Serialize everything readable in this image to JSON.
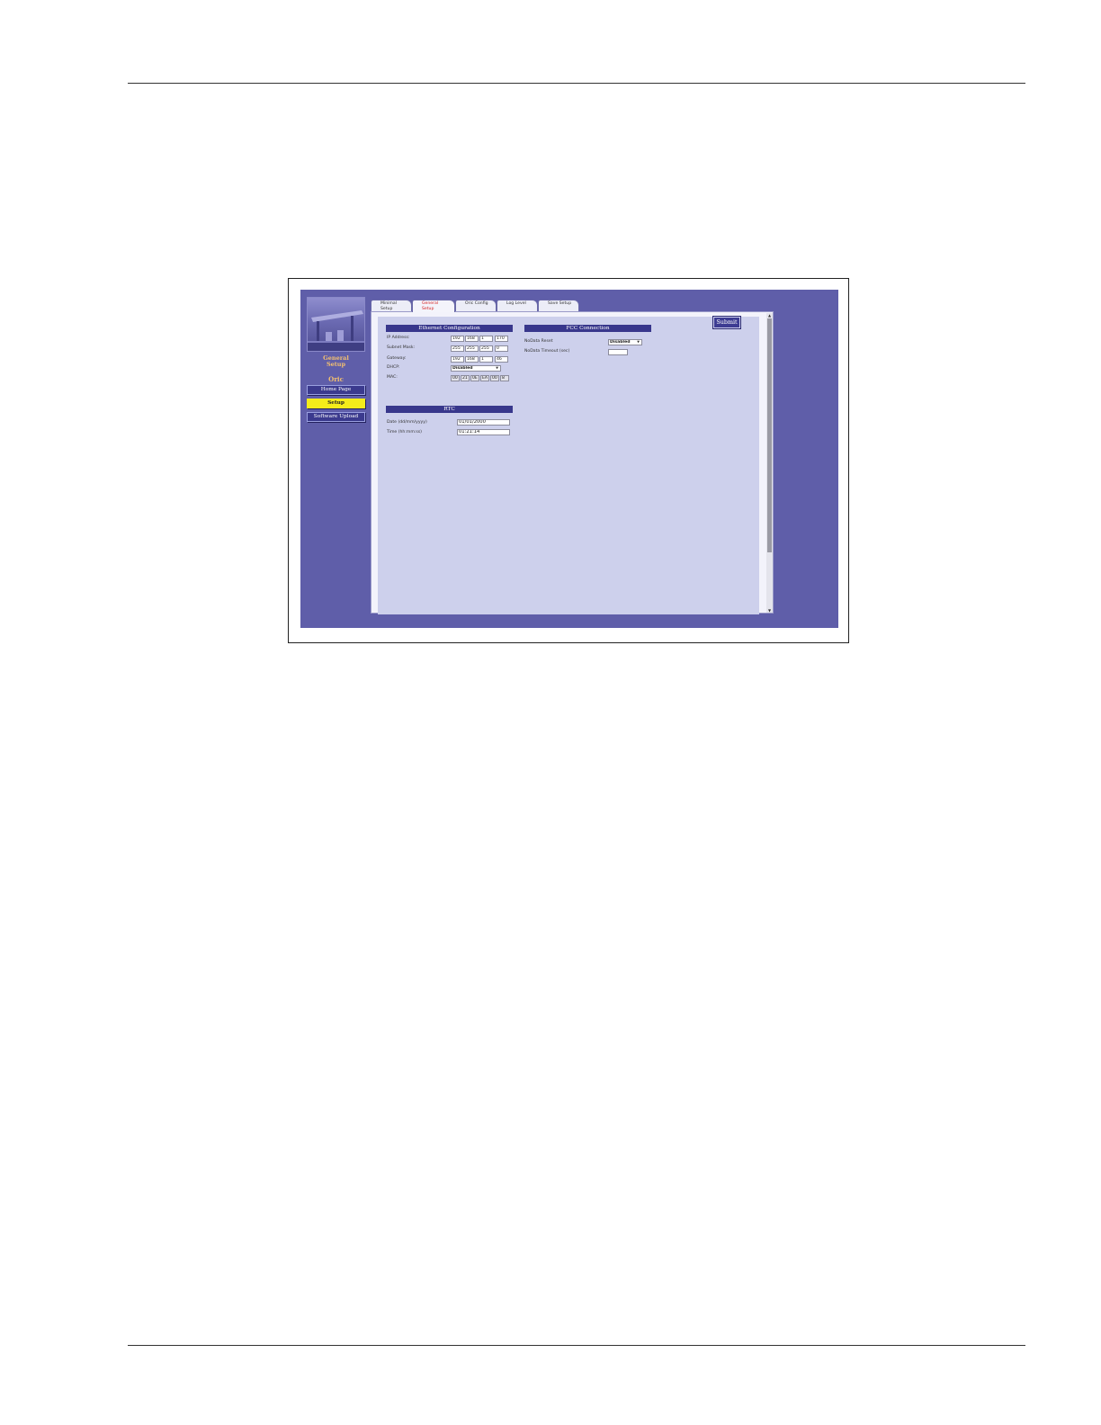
{
  "sidebar": {
    "page_title_line1": "General",
    "page_title_line2": "Setup",
    "device_name": "Oric",
    "nav": [
      {
        "label": "Home Page"
      },
      {
        "label": "Setup"
      },
      {
        "label": "Software Upload"
      }
    ]
  },
  "tabs": [
    {
      "line1": "Minimal",
      "line2": "Setup"
    },
    {
      "line1": "General",
      "line2": "Setup"
    },
    {
      "line1": "Oric Config",
      "line2": ""
    },
    {
      "line1": "Log Level",
      "line2": ""
    },
    {
      "line1": "Save Setup",
      "line2": ""
    }
  ],
  "submit_label": "Submit",
  "ethernet": {
    "title": "Ethernet Configuration",
    "ip_label": "IP Address:",
    "ip": [
      "192",
      "168",
      "1",
      "170"
    ],
    "mask_label": "Subnet Mask:",
    "mask": [
      "255",
      "255",
      "255",
      "0"
    ],
    "gateway_label": "Gateway:",
    "gateway": [
      "192",
      "168",
      "1",
      "46"
    ],
    "dhcp_label": "DHCP:",
    "dhcp_value": "Disabled",
    "mac_label": "MAC:",
    "mac": [
      "00",
      "21",
      "0E",
      "EA",
      "00",
      "8"
    ]
  },
  "fcc": {
    "title": "FCC Connection",
    "nodata_reset_label": "NoData Reset",
    "nodata_reset_value": "Disabled",
    "nodata_timeout_label": "NoData Timeout (sec)",
    "nodata_timeout_value": ""
  },
  "rtc": {
    "title": "RTC",
    "date_label": "Date  (dd/mm/yyyy)",
    "date_value": "01/01/2000",
    "time_label": "Time  (hh:mm:ss)",
    "time_value": "01:21:14"
  },
  "colors": {
    "app_background": "#5f5ea9",
    "section_header": "#38378c",
    "active_nav": "#f4ec1a",
    "active_tab_text": "#d42020",
    "panel": "#cdd0ec"
  }
}
